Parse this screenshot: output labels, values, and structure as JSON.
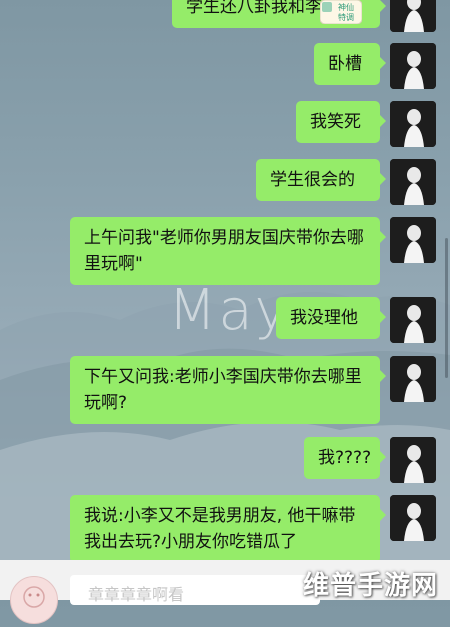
{
  "messages": [
    {
      "text": "学生还八卦我和李"
    },
    {
      "text": "卧槽"
    },
    {
      "text": "我笑死"
    },
    {
      "text": "学生很会的"
    },
    {
      "text": "上午问我\"老师你男朋友国庆带你去哪里玩啊\""
    },
    {
      "text": "我没理他"
    },
    {
      "text": "下午又问我:老师小李国庆带你去哪里玩啊?"
    },
    {
      "text": "我????"
    },
    {
      "text": "我说:小李又不是我男朋友, 他干嘛带我出去玩?小朋友你吃错瓜了"
    }
  ],
  "sticker_text": "神仙\n特调",
  "background_text": "May",
  "input": {
    "placeholder": "章章章章啊看"
  },
  "site_watermark": "维普手游网",
  "colors": {
    "bubble": "#95ec69",
    "input_bar": "#f2f2f2"
  }
}
